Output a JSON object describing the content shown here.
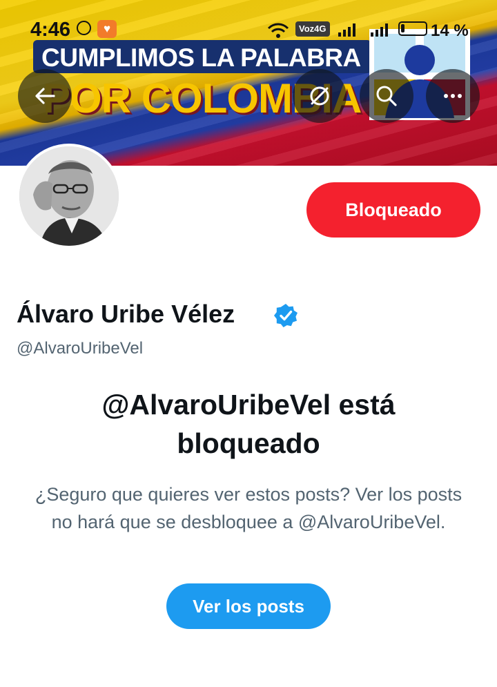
{
  "status_bar": {
    "time": "4:46",
    "network_badge": "Voz4G",
    "battery_percent": "14 %",
    "icons": [
      "whatsapp-icon",
      "app-notification-icon",
      "wifi-icon",
      "signal-icon",
      "signal-icon",
      "battery-icon"
    ]
  },
  "header": {
    "banner": {
      "line1": "CUMPLIMOS LA PALABRA",
      "line2": "POR COLOMBIA",
      "colors": {
        "yellow": "#f3cd00",
        "blue": "#1d3a9e",
        "red": "#c8102e"
      }
    },
    "buttons": [
      "back-arrow-icon",
      "grok-icon",
      "search-icon",
      "more-icon"
    ]
  },
  "profile": {
    "display_name": "Álvaro Uribe Vélez",
    "handle": "@AlvaroUribeVel",
    "verified": true,
    "blocked_button_label": "Bloqueado"
  },
  "blocked_notice": {
    "title": "@AlvaroUribeVel está bloqueado",
    "description": "¿Seguro que quieres ver estos posts? Ver los posts no hará que se desbloquee a @AlvaroUribeVel.",
    "action_label": "Ver los posts"
  },
  "colors": {
    "blocked_red": "#f4212e",
    "primary_blue": "#1d9bf0",
    "text_primary": "#0f1419",
    "text_secondary": "#536471"
  }
}
